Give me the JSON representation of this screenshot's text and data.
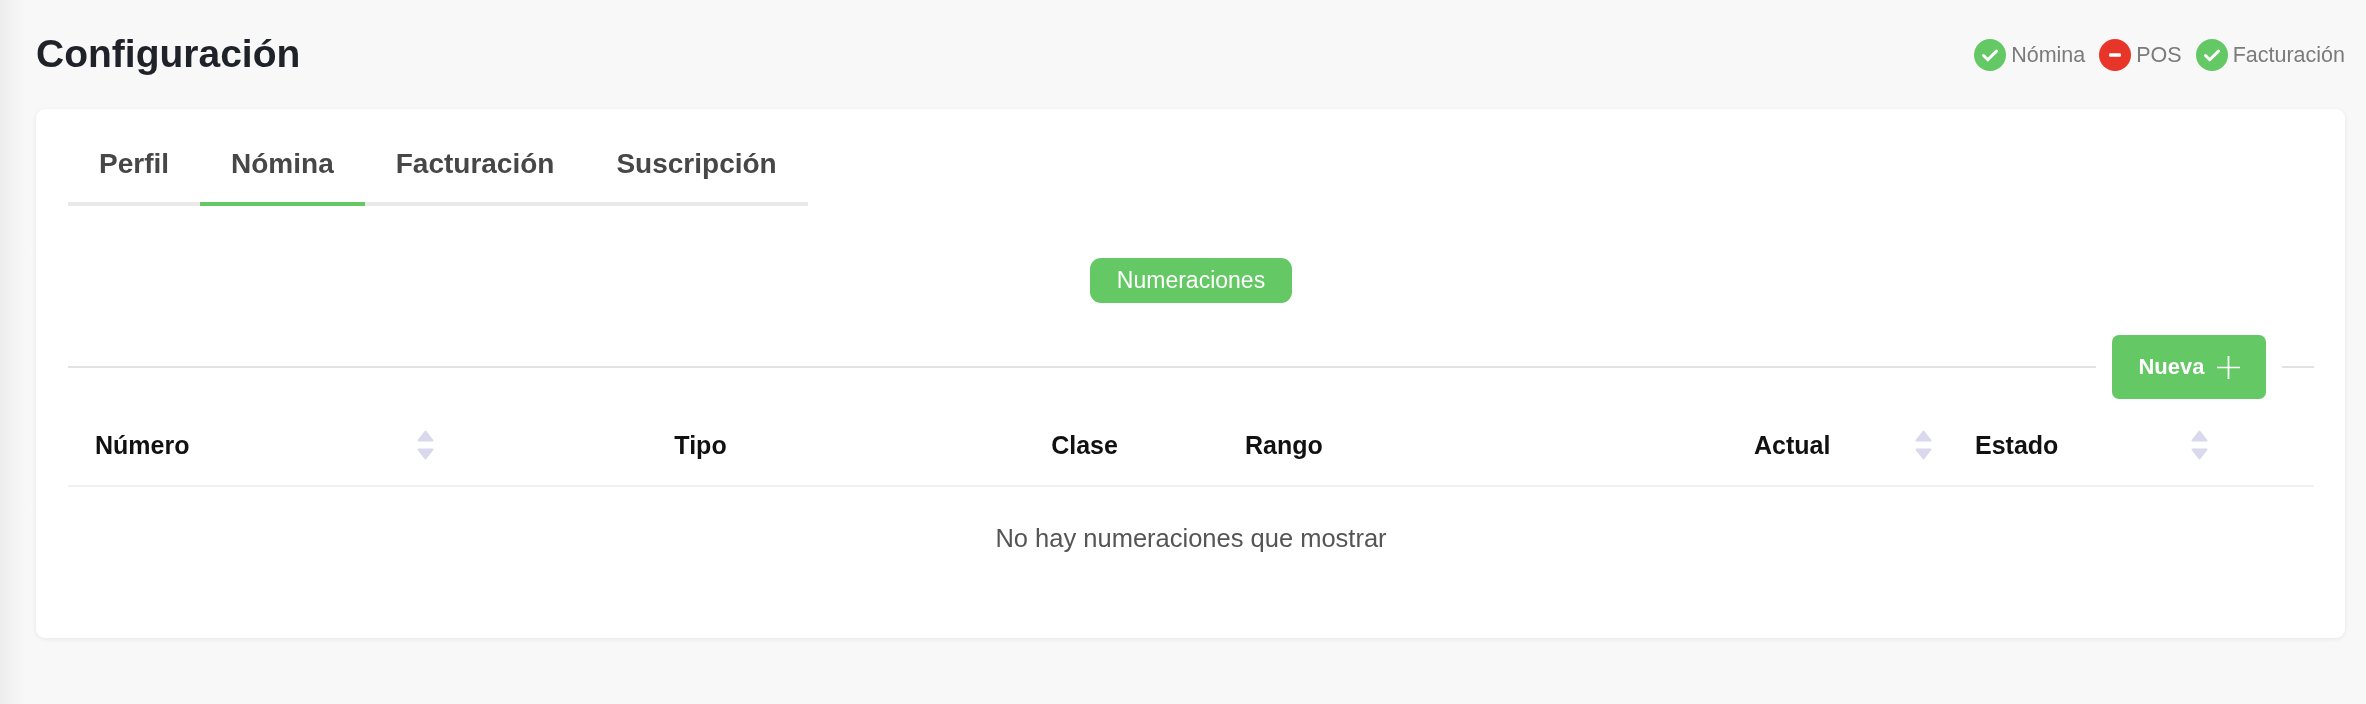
{
  "page_title": "Configuración",
  "status_badges": [
    {
      "label": "Nómina",
      "active": true
    },
    {
      "label": "POS",
      "active": false
    },
    {
      "label": "Facturación",
      "active": true
    }
  ],
  "tabs": [
    {
      "label": "Perfil",
      "selected": false
    },
    {
      "label": "Nómina",
      "selected": true
    },
    {
      "label": "Facturación",
      "selected": false
    },
    {
      "label": "Suscripción",
      "selected": false
    }
  ],
  "section_label": "Numeraciones",
  "new_button": {
    "label": "Nueva"
  },
  "table": {
    "columns": [
      {
        "label": "Número",
        "sortable": true
      },
      {
        "label": "Tipo",
        "sortable": false
      },
      {
        "label": "Clase",
        "sortable": false
      },
      {
        "label": "Rango",
        "sortable": false
      },
      {
        "label": "Actual",
        "sortable": true
      },
      {
        "label": "Estado",
        "sortable": true
      }
    ],
    "empty_message": "No hay numeraciones que mostrar"
  }
}
